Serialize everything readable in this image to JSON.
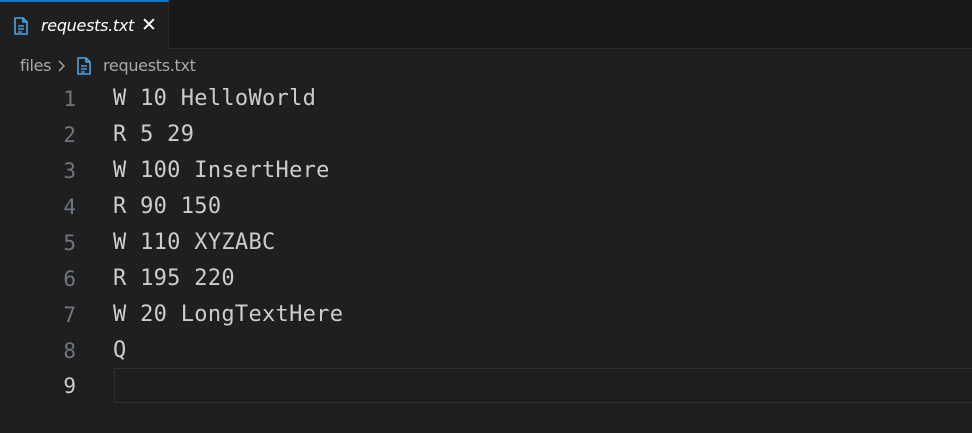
{
  "tab": {
    "label": "requests.txt",
    "close_icon": "close-icon",
    "file_icon": "file-text-icon",
    "accent_color": "#0078d4"
  },
  "breadcrumb": {
    "root": "files",
    "separator_icon": "chevron-right-icon",
    "file_icon": "file-text-icon",
    "file": "requests.txt"
  },
  "editor": {
    "lines": [
      {
        "number": "1",
        "text": "W 10 HelloWorld"
      },
      {
        "number": "2",
        "text": "R 5 29"
      },
      {
        "number": "3",
        "text": "W 100 InsertHere"
      },
      {
        "number": "4",
        "text": "R 90 150"
      },
      {
        "number": "5",
        "text": "W 110 XYZABC"
      },
      {
        "number": "6",
        "text": "R 195 220"
      },
      {
        "number": "7",
        "text": "W 20 LongTextHere"
      },
      {
        "number": "8",
        "text": "Q"
      },
      {
        "number": "9",
        "text": ""
      }
    ],
    "current_line": "9"
  }
}
